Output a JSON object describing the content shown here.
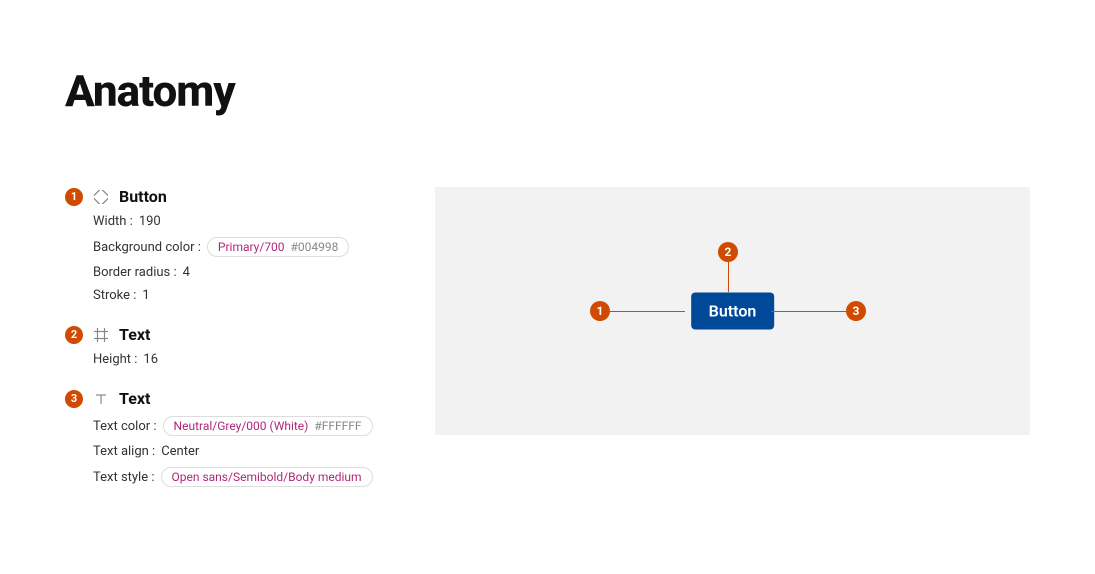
{
  "title": "Anatomy",
  "specs": [
    {
      "num": "1",
      "icon": "diamond",
      "title": "Button",
      "rows": [
        {
          "label": "Width :",
          "value": "190"
        },
        {
          "label": "Background color :",
          "chip": {
            "name": "Primary/700",
            "hex": "#004998"
          }
        },
        {
          "label": "Border radius :",
          "value": "4"
        },
        {
          "label": "Stroke :",
          "value": "1"
        }
      ]
    },
    {
      "num": "2",
      "icon": "frame",
      "title": "Text",
      "rows": [
        {
          "label": "Height :",
          "value": "16"
        }
      ]
    },
    {
      "num": "3",
      "icon": "text",
      "title": "Text",
      "rows": [
        {
          "label": "Text color :",
          "chip": {
            "name": "Neutral/Grey/000 (White)",
            "hex": "#FFFFFF"
          }
        },
        {
          "label": "Text align :",
          "value": "Center"
        },
        {
          "label": "Text style :",
          "chip": {
            "name": "Open sans/Semibold/Body medium"
          }
        }
      ]
    }
  ],
  "preview": {
    "button_label": "Button",
    "callouts": [
      "1",
      "2",
      "3"
    ]
  }
}
